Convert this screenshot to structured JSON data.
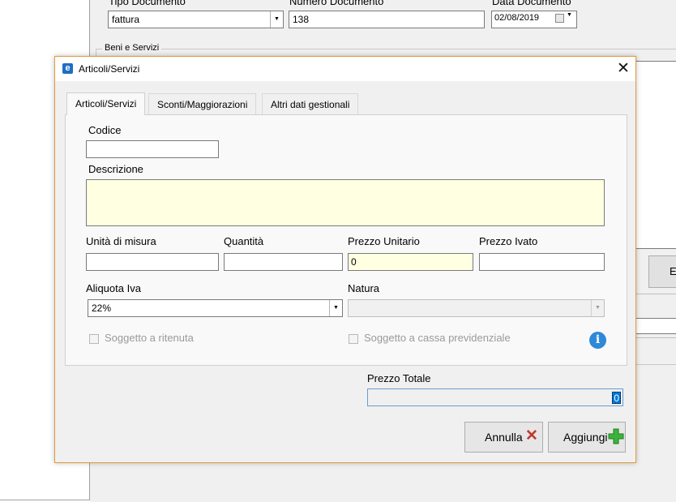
{
  "background": {
    "tipo_documento_label": "Tipo Documento",
    "tipo_documento_value": "fattura",
    "numero_documento_label": "Numero Documento",
    "numero_documento_value": "138",
    "data_documento_label": "Data Documento",
    "data_documento_value": "02/08/2019",
    "group_label": "Beni e Servizi",
    "side_button_label": "E"
  },
  "dialog": {
    "title": "Articoli/Servizi",
    "close_glyph": "✕"
  },
  "tabs": [
    {
      "label": "Articoli/Servizi",
      "active": true
    },
    {
      "label": "Sconti/Maggiorazioni",
      "active": false
    },
    {
      "label": "Altri dati gestionali",
      "active": false
    }
  ],
  "form": {
    "codice_label": "Codice",
    "codice_value": "",
    "descrizione_label": "Descrizione",
    "descrizione_value": "",
    "unita_label": "Unità di misura",
    "unita_value": "",
    "quantita_label": "Quantità",
    "quantita_value": "",
    "prezzo_unitario_label": "Prezzo Unitario",
    "prezzo_unitario_value": "0",
    "prezzo_ivato_label": "Prezzo Ivato",
    "prezzo_ivato_value": "",
    "aliquota_label": "Aliquota Iva",
    "aliquota_value": "22%",
    "natura_label": "Natura",
    "natura_value": "",
    "ritenuta_label": "Soggetto a ritenuta",
    "cassa_label": "Soggetto a cassa previdenziale",
    "info_glyph": "i"
  },
  "totale": {
    "label": "Prezzo Totale",
    "value": "0"
  },
  "buttons": {
    "annulla": "Annulla",
    "aggiungi": "Aggiungi"
  },
  "colors": {
    "accent_border": "#e29b3c",
    "required_field_bg": "#ffffe1",
    "info_icon": "#2e8ad8",
    "cancel_x": "#c0392b",
    "add_plus": "#3cb43c"
  }
}
